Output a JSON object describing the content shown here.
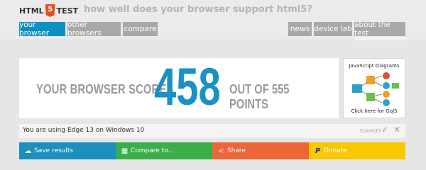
{
  "header": {
    "logo_left": "HTML",
    "logo_shield": "5",
    "logo_right": "TEST",
    "tagline": "how well does your browser support html5?"
  },
  "nav": {
    "left": [
      "your browser",
      "other browsers",
      "compare"
    ],
    "right": [
      "news",
      "device lab",
      "about the test"
    ]
  },
  "score": {
    "prefix": "YOUR BROWSER SCORES",
    "value": "458",
    "suffix": "OUT OF 555 POINTS"
  },
  "ad": {
    "title": "JavaScript Diagrams",
    "cta": "Click here for GoJS"
  },
  "info": {
    "text": "You are using Edge 13 on Windows 10",
    "correct_label": "Correct?",
    "check_icon": "check-icon",
    "close_icon": "close-icon"
  },
  "actions": {
    "save": "Save results",
    "compare": "Compare to...",
    "share": "Share",
    "donate": "Donate"
  },
  "colors": {
    "accent": "#0d8fc4",
    "save": "#1b8fbe",
    "compare": "#3aae48",
    "share": "#ed6637",
    "donate": "#f8c800"
  }
}
